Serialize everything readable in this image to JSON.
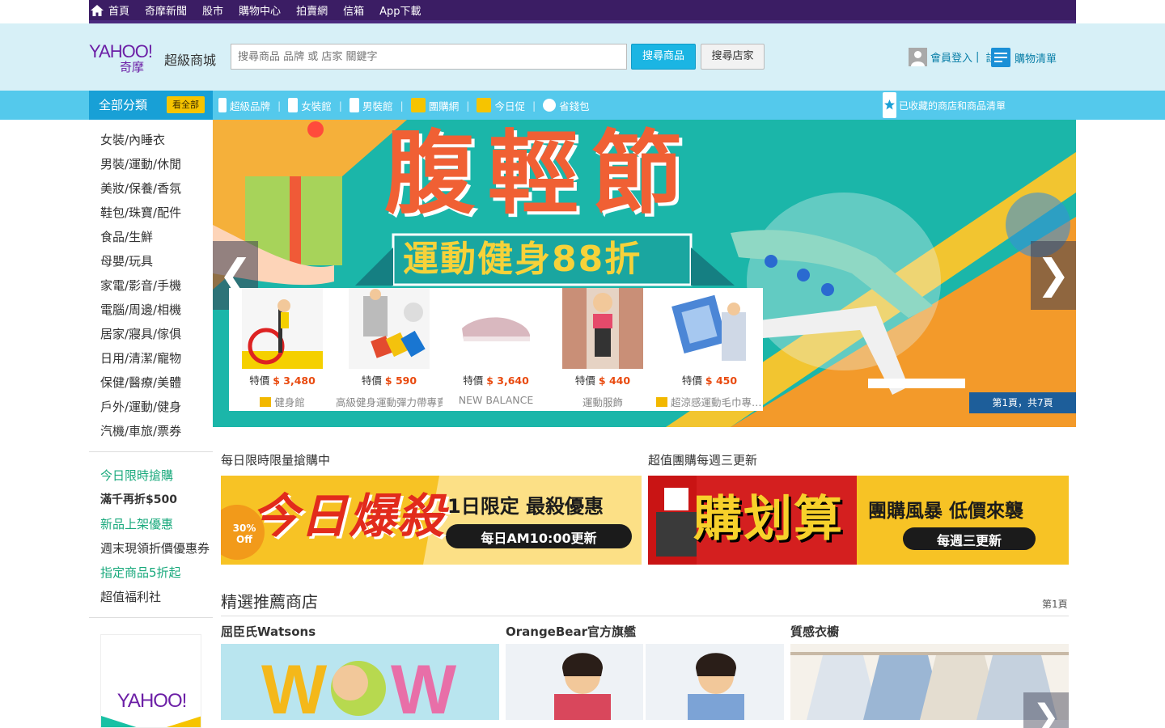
{
  "topnav": {
    "items": [
      "首頁",
      "奇摩新聞",
      "股市",
      "購物中心",
      "拍賣網",
      "信箱",
      "App下載"
    ]
  },
  "header": {
    "logo_text": "YAHOO!",
    "logo_sub": "奇摩",
    "logo_mall": "超級商城",
    "search_placeholder": "搜尋商品 品牌 或 店家 關鍵字",
    "search_button": "搜尋商品",
    "store_button": "搜尋店家",
    "login_label": "會員登入",
    "login_sep": "|",
    "register_label": "註冊",
    "cart_label": "購物清單"
  },
  "navbar": {
    "category_label": "全部分類",
    "category_badge": "看全部",
    "items": [
      "超級品牌",
      "女裝館",
      "男裝館",
      "團購網",
      "今日促",
      "省錢包"
    ],
    "right_label": "已收藏的商店和商品清單"
  },
  "sidebar": {
    "categories": [
      "女裝/內睡衣",
      "男裝/運動/休閒",
      "美妝/保養/香氛",
      "鞋包/珠寶/配件",
      "食品/生鮮",
      "母嬰/玩具",
      "家電/影音/手機",
      "電腦/周邊/相機",
      "居家/寢具/傢俱",
      "日用/清潔/寵物",
      "保健/醫療/美體",
      "戶外/運動/健身",
      "汽機/車旅/票券"
    ],
    "promos": [
      {
        "label": "今日限時搶購",
        "color": "#19a97c"
      },
      {
        "label": "滿千再折$500",
        "color": "#333333"
      },
      {
        "label": "新品上架優惠",
        "color": "#19a97c"
      },
      {
        "label": "週末現領折價優惠券",
        "color": "#333333"
      },
      {
        "label": "指定商品5折起",
        "color": "#19a97c"
      },
      {
        "label": "超值福利社",
        "color": "#333333"
      }
    ]
  },
  "banner": {
    "headline": "腹輕節",
    "subline": "運動健身88折",
    "pager": "第1頁，共7頁",
    "prev": "❮",
    "next": "❯",
    "products": [
      {
        "price_prefix": "特價",
        "price": "$ 3,480",
        "store": "健身館",
        "has_icon": true
      },
      {
        "price_prefix": "特價",
        "price": "$ 590",
        "store": "高級健身運動彈力帶專賣店",
        "has_icon": false
      },
      {
        "price_prefix": "特價",
        "price": "$ 3,640",
        "store": "NEW BALANCE",
        "has_icon": false
      },
      {
        "price_prefix": "特價",
        "price": "$ 440",
        "store": "運動服飾",
        "has_icon": false
      },
      {
        "price_prefix": "特價",
        "price": "$ 450",
        "store": "超涼感運動毛巾專賣店",
        "has_icon": true
      }
    ]
  },
  "sections": {
    "left_title": "每日限時限量搶購中",
    "right_title": "超值團購每週三更新",
    "left_banner": {
      "big": "今日爆殺",
      "line1": "1日限定 最殺優惠",
      "line2": "每日AM10:00更新",
      "tag": "30% Off"
    },
    "right_banner": {
      "big": "購划算",
      "line1": "團購風暴 低價來襲",
      "line2": "每週三更新"
    }
  },
  "recommend": {
    "title": "精選推薦商店",
    "page": "第1頁",
    "stores": [
      {
        "name": "屈臣氏Watsons"
      },
      {
        "name": "OrangeBear官方旗艦"
      },
      {
        "name": "質感衣櫥"
      }
    ]
  },
  "yapp": {
    "text": "YAHOO!"
  },
  "colors": {
    "topbar": "#3b1d64",
    "header_bg": "#d7f0f7",
    "nav_bg": "#54c9ec",
    "accent": "#1bb5e3",
    "price": "#e94a0f"
  }
}
